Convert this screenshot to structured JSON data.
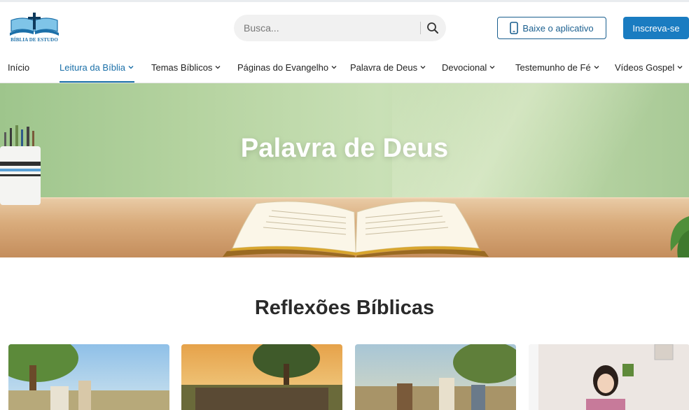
{
  "brand": {
    "logo_text": "BÍBLIA DE ESTUDO",
    "accent": "#1a6fa8",
    "button_blue": "#1a7cc1"
  },
  "search": {
    "placeholder": "Busca...",
    "icon": "search-icon"
  },
  "header_actions": {
    "app_button_label": "Baixe o aplicativo",
    "app_button_icon": "smartphone-icon",
    "subscribe_label": "Inscreva-se"
  },
  "nav": {
    "items": [
      {
        "label": "Início",
        "dropdown": false,
        "active": false
      },
      {
        "label": "Leitura da Bíblia",
        "dropdown": true,
        "active": true
      },
      {
        "label": "Temas Bíblicos",
        "dropdown": true,
        "active": false
      },
      {
        "label": "Páginas do Evangelho",
        "dropdown": true,
        "active": false
      },
      {
        "label": "Palavra de Deus",
        "dropdown": true,
        "active": false
      },
      {
        "label": "Devocional",
        "dropdown": true,
        "active": false
      },
      {
        "label": "Testemunho de Fé",
        "dropdown": true,
        "active": false
      },
      {
        "label": "Vídeos Gospel",
        "dropdown": true,
        "active": false
      }
    ]
  },
  "hero": {
    "title": "Palavra de Deus"
  },
  "reflections": {
    "title": "Reflexões Bíblicas",
    "cards": [
      {
        "image": "jesus-with-woman-at-well-image"
      },
      {
        "image": "crowd-at-sunset-image"
      },
      {
        "image": "jesus-with-disciples-image"
      },
      {
        "image": "woman-smiling-indoors-image"
      }
    ]
  }
}
